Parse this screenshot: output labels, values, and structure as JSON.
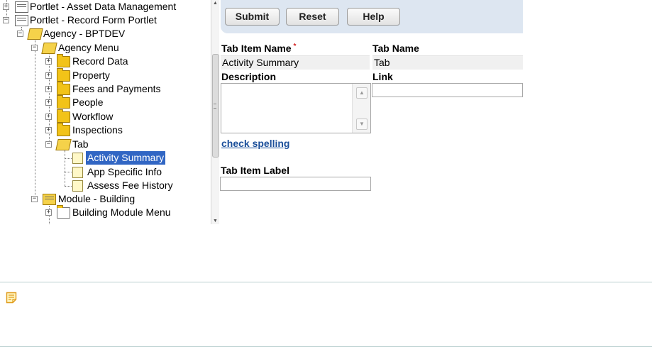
{
  "tree": {
    "nodes": [
      {
        "label": "Portlet - Asset Data Management",
        "icon": "portlet-icon",
        "expanded": false
      },
      {
        "label": "Portlet - Record Form Portlet",
        "icon": "portlet-icon",
        "expanded": true
      },
      {
        "label": "Agency - BPTDEV",
        "icon": "open-folder-icon",
        "expanded": true
      },
      {
        "label": "Agency Menu",
        "icon": "open-folder-icon",
        "expanded": true
      },
      {
        "label": "Record Data",
        "icon": "folder-icon",
        "expanded": false
      },
      {
        "label": "Property",
        "icon": "folder-icon",
        "expanded": false
      },
      {
        "label": "Fees and Payments",
        "icon": "folder-icon",
        "expanded": false
      },
      {
        "label": "People",
        "icon": "folder-icon",
        "expanded": false
      },
      {
        "label": "Workflow",
        "icon": "folder-icon",
        "expanded": false
      },
      {
        "label": "Inspections",
        "icon": "folder-icon",
        "expanded": false
      },
      {
        "label": "Tab",
        "icon": "open-folder-icon",
        "expanded": true
      },
      {
        "label": "Activity Summary",
        "icon": "document-icon",
        "selected": true
      },
      {
        "label": "App Specific Info",
        "icon": "document-icon"
      },
      {
        "label": "Assess Fee History",
        "icon": "document-icon"
      },
      {
        "label": "Module - Building",
        "icon": "module-icon",
        "expanded": true
      },
      {
        "label": "Building Module Menu",
        "icon": "folder-icon",
        "expanded": false
      }
    ]
  },
  "toolbar": {
    "submit_label": "Submit",
    "reset_label": "Reset",
    "help_label": "Help"
  },
  "form": {
    "tab_item_name_label": "Tab Item Name",
    "required_marker": "*",
    "tab_item_name_value": "Activity Summary",
    "tab_name_label": "Tab Name",
    "tab_name_value": "Tab",
    "description_label": "Description",
    "description_value": "",
    "link_label": "Link",
    "link_value": "",
    "check_spelling_label": "check spelling",
    "tab_item_label_label": "Tab Item Label",
    "tab_item_label_value": ""
  },
  "colors": {
    "toolbar_bg": "#dde6f1",
    "selection_bg": "#3166c4",
    "link_color": "#1a4e9a",
    "required_color": "#d62828",
    "divider_color": "#b9cfcf"
  }
}
